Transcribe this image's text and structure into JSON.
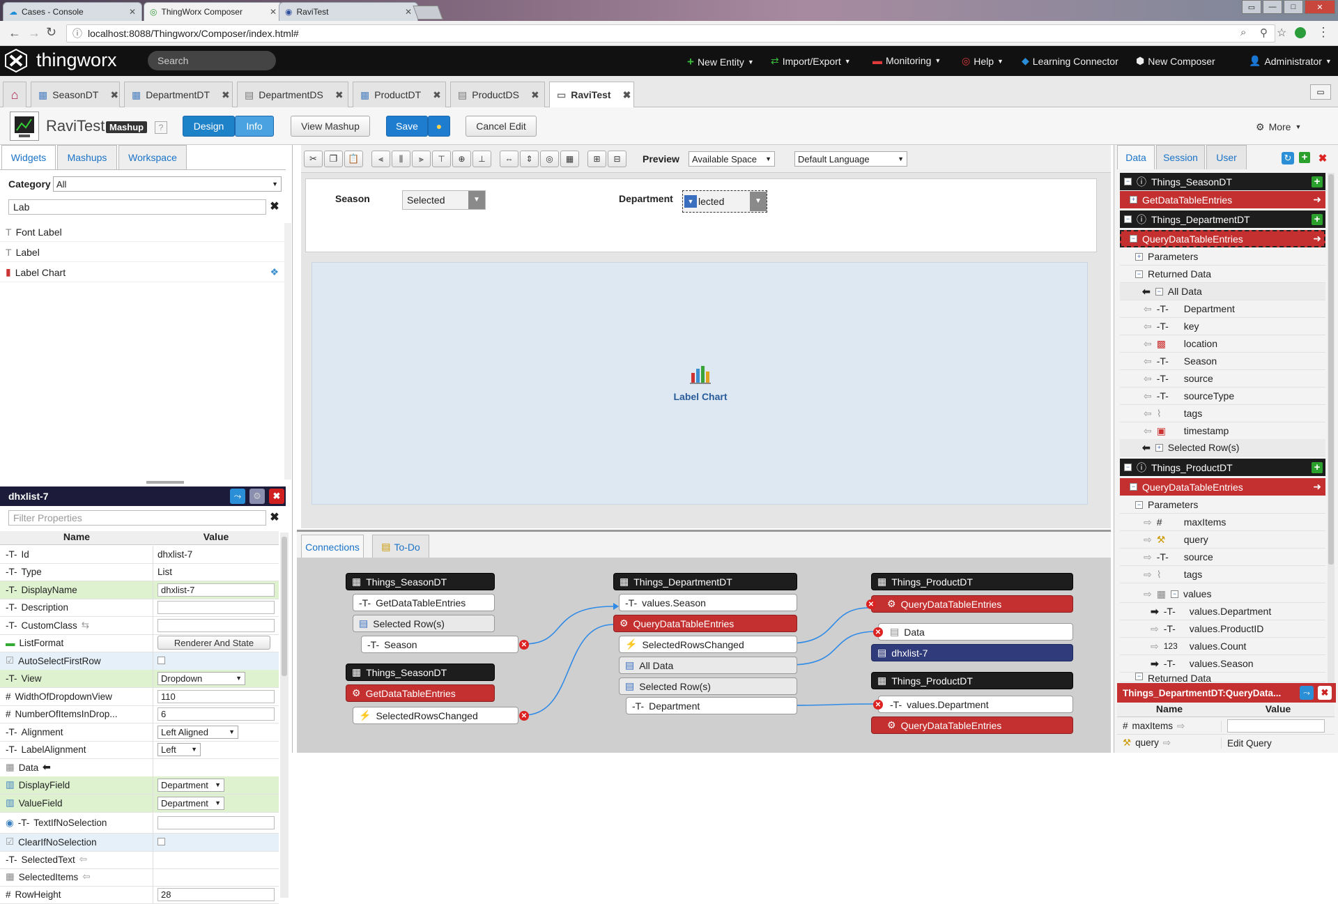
{
  "browser": {
    "tabs": [
      {
        "title": "Cases - Console"
      },
      {
        "title": "ThingWorx Composer"
      },
      {
        "title": "RaviTest"
      }
    ],
    "url": "localhost:8088/Thingworx/Composer/index.html#"
  },
  "header": {
    "logo_text": "thingworx",
    "search_placeholder": "Search",
    "menu": [
      {
        "label": "New Entity",
        "icon": "plus-icon"
      },
      {
        "label": "Import/Export",
        "icon": "transfer-icon"
      },
      {
        "label": "Monitoring",
        "icon": "monitor-icon"
      },
      {
        "label": "Help",
        "icon": "lifebuoy-icon"
      },
      {
        "label": "Learning Connector",
        "icon": "learning-icon"
      },
      {
        "label": "New Composer",
        "icon": "composer-icon"
      },
      {
        "label": "Administrator",
        "icon": "user-icon"
      }
    ]
  },
  "entity_tabs": [
    {
      "label": "SeasonDT"
    },
    {
      "label": "DepartmentDT"
    },
    {
      "label": "DepartmentDS"
    },
    {
      "label": "ProductDT"
    },
    {
      "label": "ProductDS"
    },
    {
      "label": "RaviTest"
    }
  ],
  "toolbar": {
    "entity_name": "RaviTest",
    "entity_type": "Mashup",
    "help": "?",
    "design": "Design",
    "info": "Info",
    "view_mashup": "View Mashup",
    "save": "Save",
    "cancel_edit": "Cancel Edit",
    "more": "More"
  },
  "left_panel": {
    "tabs": [
      "Widgets",
      "Mashups",
      "Workspace"
    ],
    "category_label": "Category",
    "category_value": "All",
    "filter_value": "Lab",
    "widgets": [
      "Font Label",
      "Label",
      "Label Chart"
    ]
  },
  "properties": {
    "widget_id": "dhxlist-7",
    "filter_placeholder": "Filter Properties",
    "col_name": "Name",
    "col_value": "Value",
    "rows": [
      {
        "name": "Id",
        "value": "dhxlist-7"
      },
      {
        "name": "Type",
        "value": "List"
      },
      {
        "name": "DisplayName",
        "value": "dhxlist-7"
      },
      {
        "name": "Description",
        "value": ""
      },
      {
        "name": "CustomClass",
        "value": ""
      },
      {
        "name": "ListFormat",
        "value": "Renderer And State"
      },
      {
        "name": "AutoSelectFirstRow",
        "value": ""
      },
      {
        "name": "View",
        "value": "Dropdown"
      },
      {
        "name": "WidthOfDropdownView",
        "value": "110"
      },
      {
        "name": "NumberOfItemsInDrop...",
        "value": "6"
      },
      {
        "name": "Alignment",
        "value": "Left Aligned"
      },
      {
        "name": "LabelAlignment",
        "value": "Left"
      },
      {
        "name": "Data",
        "value": ""
      },
      {
        "name": "DisplayField",
        "value": "Department"
      },
      {
        "name": "ValueField",
        "value": "Department"
      },
      {
        "name": "TextIfNoSelection",
        "value": ""
      },
      {
        "name": "ClearIfNoSelection",
        "value": ""
      },
      {
        "name": "SelectedText",
        "value": ""
      },
      {
        "name": "SelectedItems",
        "value": ""
      },
      {
        "name": "RowHeight",
        "value": "28"
      }
    ]
  },
  "canvas_bar": {
    "preview_label": "Preview",
    "space_value": "Available Space",
    "language_value": "Default Language"
  },
  "mashup": {
    "season_label": "Season",
    "season_value": "Selected",
    "department_label": "Department",
    "department_value": "lected",
    "chart_label": "Label Chart"
  },
  "connections": {
    "tabs": [
      "Connections",
      "To-Do"
    ],
    "col1": {
      "a_title": "Things_SeasonDT",
      "a_service": "GetDataTableEntries",
      "a_rows": "Selected Row(s)",
      "a_field": "Season",
      "b_title": "Things_SeasonDT",
      "b_service": "GetDataTableEntries",
      "b_event": "SelectedRowsChanged"
    },
    "col2": {
      "title": "Things_DepartmentDT",
      "param": "values.Season",
      "service": "QueryDataTableEntries",
      "event": "SelectedRowsChanged",
      "all": "All Data",
      "rows": "Selected Row(s)",
      "field": "Department"
    },
    "col3": {
      "a_title": "Things_ProductDT",
      "a_service": "QueryDataTableEntries",
      "a_data": "Data",
      "a_widget": "dhxlist-7",
      "b_title": "Things_ProductDT",
      "b_param": "values.Department",
      "b_service": "QueryDataTableEntries"
    }
  },
  "right_panel": {
    "tabs": [
      "Data",
      "Session",
      "User"
    ],
    "tree": [
      {
        "kind": "black",
        "label": "Things_SeasonDT"
      },
      {
        "kind": "red",
        "label": "GetDataTableEntries"
      },
      {
        "kind": "black",
        "label": "Things_DepartmentDT"
      },
      {
        "kind": "red",
        "label": "QueryDataTableEntries"
      },
      {
        "kind": "plain",
        "label": "Parameters"
      },
      {
        "kind": "plain",
        "label": "Returned Data"
      },
      {
        "kind": "plain",
        "label": "All Data"
      },
      {
        "kind": "plain",
        "label": "Department"
      },
      {
        "kind": "plain",
        "label": "key"
      },
      {
        "kind": "plain",
        "label": "location"
      },
      {
        "kind": "plain",
        "label": "Season"
      },
      {
        "kind": "plain",
        "label": "source"
      },
      {
        "kind": "plain",
        "label": "sourceType"
      },
      {
        "kind": "plain",
        "label": "tags"
      },
      {
        "kind": "plain",
        "label": "timestamp"
      },
      {
        "kind": "plain",
        "label": "Selected Row(s)"
      },
      {
        "kind": "black",
        "label": "Things_ProductDT"
      },
      {
        "kind": "red",
        "label": "QueryDataTableEntries"
      },
      {
        "kind": "plain",
        "label": "Parameters"
      },
      {
        "kind": "plain",
        "label": "maxItems"
      },
      {
        "kind": "plain",
        "label": "query"
      },
      {
        "kind": "plain",
        "label": "source"
      },
      {
        "kind": "plain",
        "label": "tags"
      },
      {
        "kind": "plain",
        "label": "values"
      },
      {
        "kind": "plain",
        "label": "values.Department"
      },
      {
        "kind": "plain",
        "label": "values.ProductID"
      },
      {
        "kind": "plain",
        "label": "values.Count"
      },
      {
        "kind": "plain",
        "label": "values.Season"
      },
      {
        "kind": "plain",
        "label": "Returned Data"
      }
    ],
    "bottom_title": "Things_DepartmentDT:QueryData...",
    "bottom_col_name": "Name",
    "bottom_col_value": "Value",
    "bottom_rows": [
      {
        "name": "maxItems",
        "value": ""
      },
      {
        "name": "query",
        "value": "Edit Query"
      }
    ]
  }
}
